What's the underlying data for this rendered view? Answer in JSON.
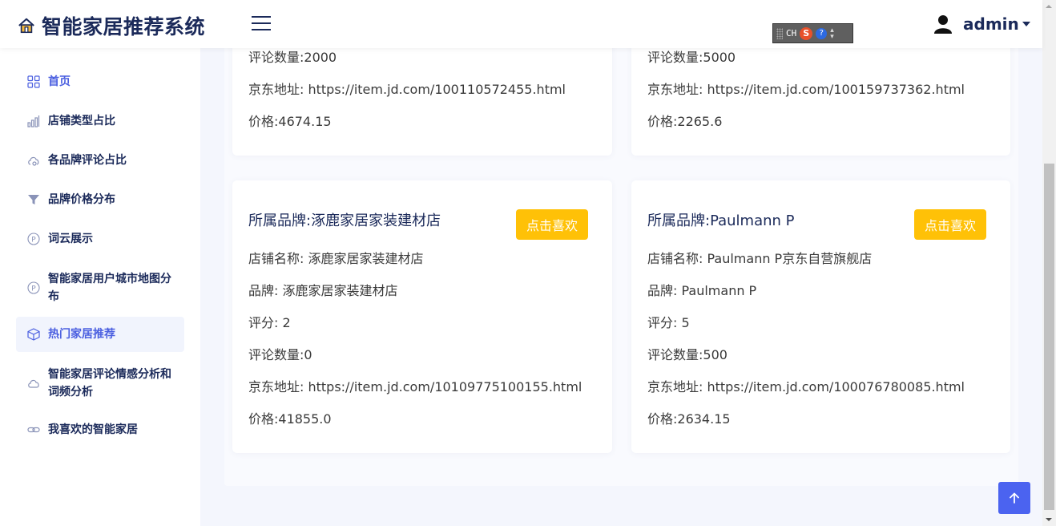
{
  "header": {
    "title": "智能家居推荐系统",
    "ime": {
      "lang": "CH",
      "s_logo": "S",
      "help": "?"
    },
    "user": "admin"
  },
  "sidebar": {
    "items": [
      {
        "label": "首页",
        "icon": "grid-icon",
        "active": false
      },
      {
        "label": "店铺类型占比",
        "icon": "bar-chart-icon",
        "active": false
      },
      {
        "label": "各品牌评论占比",
        "icon": "cloud-settings-icon",
        "active": false
      },
      {
        "label": "品牌价格分布",
        "icon": "filter-icon",
        "active": false
      },
      {
        "label": "词云展示",
        "icon": "p-circle-icon",
        "active": false
      },
      {
        "label": "智能家居用户城市地图分布",
        "icon": "p-circle-icon",
        "active": false
      },
      {
        "label": "热门家居推荐",
        "icon": "box-icon",
        "active": true
      },
      {
        "label": "智能家居评论情感分析和词频分析",
        "icon": "cloud-icon",
        "active": false
      },
      {
        "label": "我喜欢的智能家居",
        "icon": "link-icon",
        "active": false
      }
    ]
  },
  "cards_top": [
    {
      "comments": "评论数量:2000",
      "url": "京东地址: https://item.jd.com/100110572455.html",
      "price": "价格:4674.15"
    },
    {
      "comments": "评论数量:5000",
      "url": "京东地址: https://item.jd.com/100159737362.html",
      "price": "价格:2265.6"
    }
  ],
  "cards": [
    {
      "title": "所属品牌:涿鹿家居家装建材店",
      "shop": "店铺名称: 涿鹿家居家装建材店",
      "brand": "品牌: 涿鹿家居家装建材店",
      "score": "评分: 2",
      "comments": "评论数量:0",
      "url": "京东地址: https://item.jd.com/10109775100155.html",
      "price": "价格:41855.0",
      "like_label": "点击喜欢"
    },
    {
      "title": "所属品牌:Paulmann P",
      "shop": "店铺名称: Paulmann P京东自营旗舰店",
      "brand": "品牌: Paulmann P",
      "score": "评分: 5",
      "comments": "评论数量:500",
      "url": "京东地址: https://item.jd.com/100076780085.html",
      "price": "价格:2634.15",
      "like_label": "点击喜欢"
    }
  ],
  "colors": {
    "accent": "#4b5fe0",
    "like_button": "#ffc107",
    "to_top": "#4b63f0",
    "title": "#1b2a5a"
  }
}
